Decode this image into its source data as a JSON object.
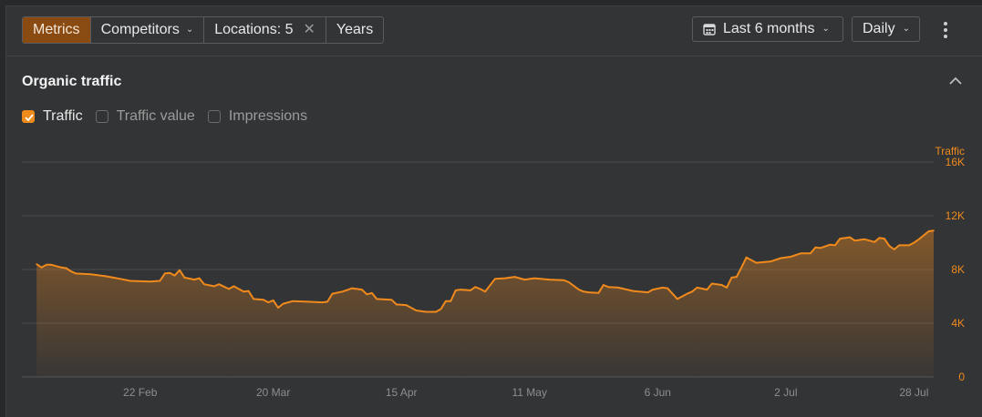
{
  "toolbar": {
    "tabs": [
      {
        "label": "Metrics",
        "active": true
      },
      {
        "label": "Competitors",
        "active": false
      },
      {
        "label": "Locations: 5",
        "active": false
      },
      {
        "label": "Years",
        "active": false
      }
    ],
    "date_range": "Last 6 months",
    "interval": "Daily"
  },
  "section": {
    "title": "Organic traffic",
    "checkboxes": [
      {
        "label": "Traffic",
        "checked": true
      },
      {
        "label": "Traffic value",
        "checked": false
      },
      {
        "label": "Impressions",
        "checked": false
      }
    ]
  },
  "colors": {
    "accent": "#f08a1c",
    "accent_dark": "#8a4b12"
  },
  "icons": [
    "calendar-icon",
    "chevron-down-icon",
    "close-icon",
    "more-vertical-icon",
    "chevron-up-icon",
    "check-icon"
  ],
  "chart_data": {
    "type": "area",
    "series": [
      {
        "name": "Traffic"
      }
    ],
    "ylabel": "Traffic",
    "ylim": [
      0,
      16000
    ],
    "yticks": [
      0,
      4000,
      8000,
      12000,
      16000
    ],
    "ytick_labels": [
      "0",
      "4K",
      "8K",
      "12K",
      "16K"
    ],
    "xlim": [
      "2024-01-29",
      "2024-08-01"
    ],
    "xtick_dates": [
      "2024-02-22",
      "2024-03-20",
      "2024-04-15",
      "2024-05-11",
      "2024-06-06",
      "2024-07-02",
      "2024-07-28"
    ],
    "xtick_labels": [
      "22 Feb",
      "20 Mar",
      "15 Apr",
      "11 May",
      "6 Jun",
      "2 Jul",
      "28 Jul"
    ],
    "grid": true,
    "points": [
      [
        "2024-02-01",
        8400
      ],
      [
        "2024-02-02",
        8150
      ],
      [
        "2024-02-03",
        8350
      ],
      [
        "2024-02-04",
        8350
      ],
      [
        "2024-02-06",
        8150
      ],
      [
        "2024-02-07",
        8100
      ],
      [
        "2024-02-08",
        7850
      ],
      [
        "2024-02-09",
        7700
      ],
      [
        "2024-02-12",
        7650
      ],
      [
        "2024-02-15",
        7500
      ],
      [
        "2024-02-18",
        7300
      ],
      [
        "2024-02-20",
        7150
      ],
      [
        "2024-02-24",
        7100
      ],
      [
        "2024-02-26",
        7150
      ],
      [
        "2024-02-27",
        7700
      ],
      [
        "2024-02-28",
        7750
      ],
      [
        "2024-02-29",
        7550
      ],
      [
        "2024-03-01",
        7950
      ],
      [
        "2024-03-02",
        7400
      ],
      [
        "2024-03-04",
        7250
      ],
      [
        "2024-03-05",
        7350
      ],
      [
        "2024-03-06",
        6900
      ],
      [
        "2024-03-08",
        6750
      ],
      [
        "2024-03-09",
        6900
      ],
      [
        "2024-03-11",
        6550
      ],
      [
        "2024-03-12",
        6750
      ],
      [
        "2024-03-14",
        6350
      ],
      [
        "2024-03-15",
        6400
      ],
      [
        "2024-03-16",
        5800
      ],
      [
        "2024-03-18",
        5750
      ],
      [
        "2024-03-19",
        5550
      ],
      [
        "2024-03-20",
        5700
      ],
      [
        "2024-03-21",
        5150
      ],
      [
        "2024-03-22",
        5450
      ],
      [
        "2024-03-24",
        5650
      ],
      [
        "2024-03-27",
        5600
      ],
      [
        "2024-03-30",
        5550
      ],
      [
        "2024-03-31",
        5600
      ],
      [
        "2024-04-01",
        6200
      ],
      [
        "2024-04-03",
        6350
      ],
      [
        "2024-04-05",
        6600
      ],
      [
        "2024-04-07",
        6500
      ],
      [
        "2024-04-08",
        6150
      ],
      [
        "2024-04-09",
        6250
      ],
      [
        "2024-04-10",
        5800
      ],
      [
        "2024-04-13",
        5750
      ],
      [
        "2024-04-14",
        5400
      ],
      [
        "2024-04-16",
        5350
      ],
      [
        "2024-04-18",
        4950
      ],
      [
        "2024-04-20",
        4850
      ],
      [
        "2024-04-22",
        4850
      ],
      [
        "2024-04-23",
        5050
      ],
      [
        "2024-04-24",
        5650
      ],
      [
        "2024-04-25",
        5650
      ],
      [
        "2024-04-26",
        6450
      ],
      [
        "2024-04-27",
        6500
      ],
      [
        "2024-04-29",
        6450
      ],
      [
        "2024-04-30",
        6700
      ],
      [
        "2024-05-01",
        6550
      ],
      [
        "2024-05-02",
        6350
      ],
      [
        "2024-05-04",
        7300
      ],
      [
        "2024-05-06",
        7350
      ],
      [
        "2024-05-08",
        7450
      ],
      [
        "2024-05-10",
        7250
      ],
      [
        "2024-05-12",
        7350
      ],
      [
        "2024-05-15",
        7250
      ],
      [
        "2024-05-18",
        7200
      ],
      [
        "2024-05-19",
        7050
      ],
      [
        "2024-05-21",
        6500
      ],
      [
        "2024-05-22",
        6350
      ],
      [
        "2024-05-23",
        6300
      ],
      [
        "2024-05-25",
        6250
      ],
      [
        "2024-05-26",
        6850
      ],
      [
        "2024-05-27",
        6700
      ],
      [
        "2024-05-29",
        6650
      ],
      [
        "2024-06-01",
        6400
      ],
      [
        "2024-06-04",
        6300
      ],
      [
        "2024-06-05",
        6500
      ],
      [
        "2024-06-07",
        6650
      ],
      [
        "2024-06-08",
        6600
      ],
      [
        "2024-06-10",
        5800
      ],
      [
        "2024-06-12",
        6200
      ],
      [
        "2024-06-13",
        6350
      ],
      [
        "2024-06-14",
        6650
      ],
      [
        "2024-06-16",
        6500
      ],
      [
        "2024-06-17",
        6950
      ],
      [
        "2024-06-19",
        6850
      ],
      [
        "2024-06-20",
        6650
      ],
      [
        "2024-06-21",
        7400
      ],
      [
        "2024-06-22",
        7450
      ],
      [
        "2024-06-23",
        8150
      ],
      [
        "2024-06-24",
        8900
      ],
      [
        "2024-06-26",
        8500
      ],
      [
        "2024-06-29",
        8600
      ],
      [
        "2024-07-01",
        8850
      ],
      [
        "2024-07-03",
        8950
      ],
      [
        "2024-07-05",
        9200
      ],
      [
        "2024-07-07",
        9200
      ],
      [
        "2024-07-08",
        9650
      ],
      [
        "2024-07-09",
        9600
      ],
      [
        "2024-07-11",
        9850
      ],
      [
        "2024-07-12",
        9800
      ],
      [
        "2024-07-13",
        10300
      ],
      [
        "2024-07-15",
        10400
      ],
      [
        "2024-07-16",
        10150
      ],
      [
        "2024-07-18",
        10250
      ],
      [
        "2024-07-20",
        10050
      ],
      [
        "2024-07-21",
        10350
      ],
      [
        "2024-07-22",
        10300
      ],
      [
        "2024-07-23",
        9750
      ],
      [
        "2024-07-24",
        9500
      ],
      [
        "2024-07-25",
        9800
      ],
      [
        "2024-07-27",
        9800
      ],
      [
        "2024-07-28",
        10000
      ],
      [
        "2024-07-29",
        10250
      ],
      [
        "2024-07-30",
        10550
      ],
      [
        "2024-07-31",
        10850
      ],
      [
        "2024-08-01",
        10900
      ]
    ]
  }
}
